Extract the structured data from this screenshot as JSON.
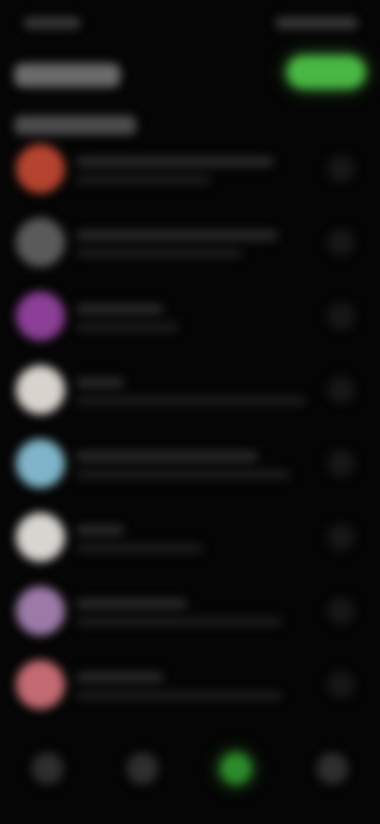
{
  "screen": {
    "background": "#050505",
    "blurred": true
  },
  "status_bar": {
    "time_mark_color": "#3a3a3a",
    "icons": [
      "signal-icon",
      "wifi-icon",
      "battery-icon"
    ],
    "icons_color": "#3b3b3b"
  },
  "header": {
    "title_mark_color": "#6b6b6b",
    "action_button": {
      "icon": "pill-button",
      "color": "#49b843"
    }
  },
  "section": {
    "title_mark_color": "#4d4d4d"
  },
  "list": {
    "items": [
      {
        "avatar_color": "#b4442f",
        "trailing_icon": "toggle-icon"
      },
      {
        "avatar_color": "#5a5a5a",
        "trailing_icon": "toggle-icon"
      },
      {
        "avatar_color": "#8b3f96",
        "trailing_icon": "toggle-icon"
      },
      {
        "avatar_color": "#d9d3cd",
        "trailing_icon": "toggle-icon"
      },
      {
        "avatar_color": "#7fb4c8",
        "trailing_icon": "toggle-icon"
      },
      {
        "avatar_color": "#d7d5cf",
        "trailing_icon": "toggle-icon"
      },
      {
        "avatar_color": "#9c7aa8",
        "trailing_icon": "toggle-icon"
      },
      {
        "avatar_color": "#c36a72",
        "trailing_icon": "toggle-icon"
      }
    ]
  },
  "bottom_nav": {
    "items": [
      {
        "icon": "home-icon",
        "active": false
      },
      {
        "icon": "search-icon",
        "active": false
      },
      {
        "icon": "activity-icon",
        "active": true
      },
      {
        "icon": "profile-icon",
        "active": false
      }
    ],
    "active_color": "#2d8b2a",
    "inactive_color": "#2e2e2e"
  }
}
